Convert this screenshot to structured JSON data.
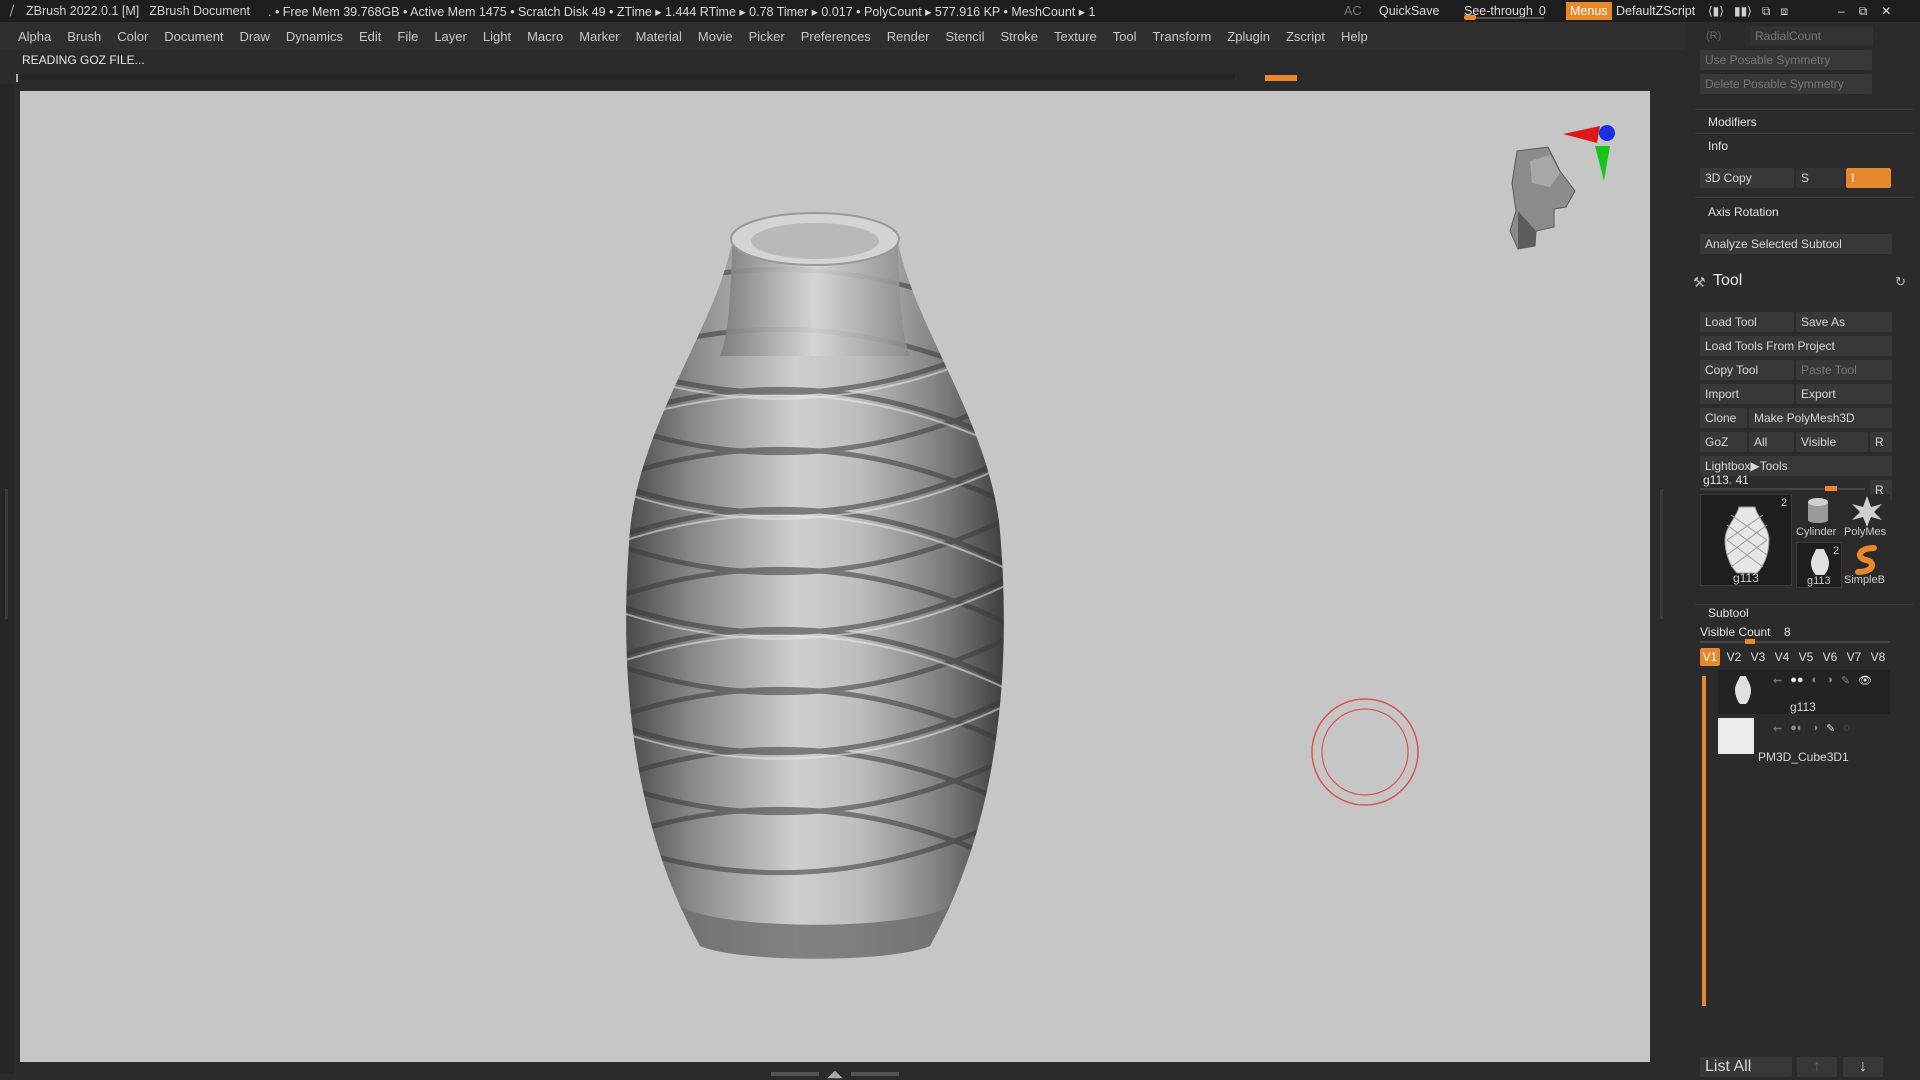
{
  "titlebar": {
    "app": "ZBrush 2022.0.1 [M]",
    "document": "ZBrush Document",
    "stats": ". • Free Mem 39.768GB • Active Mem 1475 • Scratch Disk 49 •  ZTime ▸ 1.444 RTime ▸ 0.78 Timer ▸ 0.017 • PolyCount ▸ 577.916 KP  • MeshCount ▸ 1",
    "ac": "AC",
    "quicksave": "QuickSave",
    "seethrough_label": "See-through",
    "seethrough_value": "0",
    "menus": "Menus",
    "defaultzscript": "DefaultZScript"
  },
  "menubar": [
    "Alpha",
    "Brush",
    "Color",
    "Document",
    "Draw",
    "Dynamics",
    "Edit",
    "File",
    "Layer",
    "Light",
    "Macro",
    "Marker",
    "Material",
    "Movie",
    "Picker",
    "Preferences",
    "Render",
    "Stencil",
    "Stroke",
    "Texture",
    "Tool",
    "Transform",
    "Zplugin",
    "Zscript",
    "Help"
  ],
  "status": "READING GOZ FILE...",
  "panel": {
    "r_label": "(R)",
    "radialcount": "RadialCount",
    "use_posable": "Use Posable Symmetry",
    "delete_posable": "Delete Posable Symmetry",
    "modifiers": "Modifiers",
    "info": "Info",
    "copy3d": "3D Copy",
    "s_label": "S",
    "i_label": "I",
    "axis_rotation": "Axis Rotation",
    "analyze": "Analyze Selected Subtool",
    "tool_title": "Tool",
    "load_tool": "Load Tool",
    "save_as": "Save As",
    "load_from_project": "Load Tools From Project",
    "copy_tool": "Copy Tool",
    "paste_tool": "Paste Tool",
    "import": "Import",
    "export": "Export",
    "clone": "Clone",
    "make_polymesh": "Make PolyMesh3D",
    "goz": "GoZ",
    "all": "All",
    "visible": "Visible",
    "r": "R",
    "lightbox_tools": "Lightbox▶Tools",
    "current_tool": "g113. 41",
    "thumbs": {
      "main_label": "g113",
      "main_badge": "2",
      "cylinder": "Cylinder",
      "polymesh": "PolyMes",
      "g113_small": "g113",
      "g113_badge": "2",
      "simpleb": "SimpleB"
    },
    "subtool": "Subtool",
    "visible_count_label": "Visible Count",
    "visible_count_value": "8",
    "vtabs": [
      "V1",
      "V2",
      "V3",
      "V4",
      "V5",
      "V6",
      "V7",
      "V8"
    ],
    "subtools": [
      "g113",
      "PM3D_Cube3D1"
    ],
    "list_all": "List All"
  },
  "colors": {
    "accent": "#e8872c",
    "canvas": "#c6c6c6",
    "panel": "#2b2b2b"
  }
}
